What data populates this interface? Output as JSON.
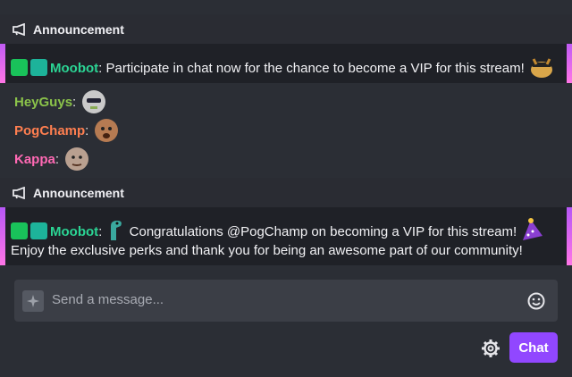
{
  "announcements": [
    {
      "header": "Announcement",
      "username": "Moobot",
      "message": "Participate in chat now for the chance to become a VIP for this stream!"
    },
    {
      "header": "Announcement",
      "username": "Moobot",
      "message_line1": "Congratulations @PogChamp on becoming a VIP for this stream!",
      "message_line2": "Enjoy the exclusive perks and thank you for being an awesome part of our community!"
    }
  ],
  "emote_lines": [
    {
      "name": "HeyGuys",
      "color": "#8bc34a"
    },
    {
      "name": "PogChamp",
      "color": "#ff7f50"
    },
    {
      "name": "Kappa",
      "color": "#ff69b4"
    }
  ],
  "input": {
    "placeholder": "Send a message..."
  },
  "chat_button": "Chat",
  "colors": {
    "accent": "#9147ff",
    "moobot": "#2bd494"
  }
}
